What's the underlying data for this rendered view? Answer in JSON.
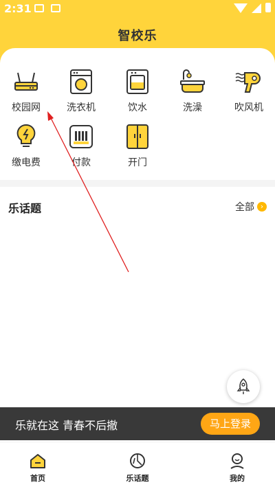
{
  "status": {
    "time": "2:31"
  },
  "app": {
    "title": "智校乐"
  },
  "services": [
    {
      "label": "校园网",
      "icon": "router-icon"
    },
    {
      "label": "洗衣机",
      "icon": "washing-machine-icon"
    },
    {
      "label": "饮水",
      "icon": "water-dispenser-icon"
    },
    {
      "label": "洗澡",
      "icon": "bathtub-icon"
    },
    {
      "label": "吹风机",
      "icon": "hair-dryer-icon"
    },
    {
      "label": "缴电费",
      "icon": "lightbulb-icon"
    },
    {
      "label": "付款",
      "icon": "payment-icon"
    },
    {
      "label": "开门",
      "icon": "door-icon"
    }
  ],
  "topics": {
    "title": "乐话题",
    "all_label": "全部"
  },
  "banner": {
    "message": "乐就在这 青春不后撤",
    "login_label": "马上登录"
  },
  "tabs": [
    {
      "label": "首页",
      "icon": "home-icon"
    },
    {
      "label": "乐话题",
      "icon": "topic-icon"
    },
    {
      "label": "我的",
      "icon": "profile-icon"
    }
  ],
  "colors": {
    "brand": "#FFD43B",
    "accent": "#FFA615",
    "icon_fill": "#FFD43B",
    "annotation": "#E02020"
  }
}
